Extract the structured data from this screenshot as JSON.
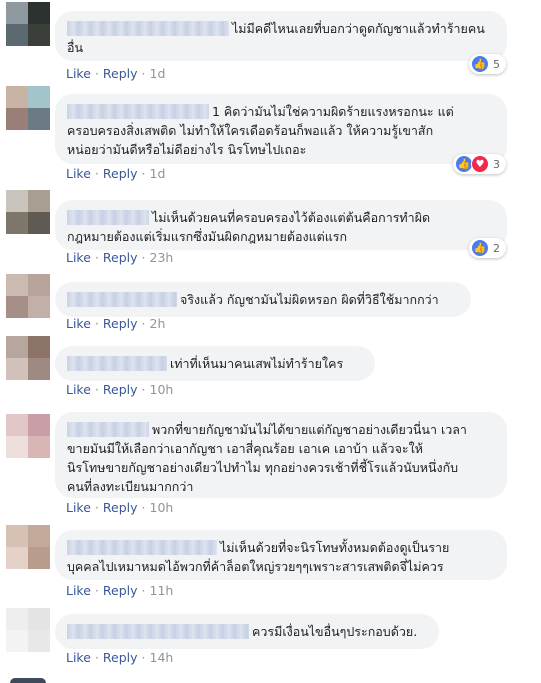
{
  "colors": {
    "link": "#385898",
    "bubble": "#f2f3f5",
    "meta": "#90949c",
    "like": "#4a7cf0",
    "love": "#f0284a"
  },
  "actions": {
    "like": "Like",
    "reply": "Reply",
    "separator": "·"
  },
  "comments": [
    {
      "text": "ไม่มีคดีไหนเลยที่บอกว่าดูดกัญชาแล้วทำร้ายคน\nอื่น",
      "time": "1d",
      "reactions": {
        "icons": [
          "like-icon"
        ],
        "count": "5"
      }
    },
    {
      "text": "1 คิดว่ามันไม่ใช่ความผิดร้ายแรงหรอกนะ แต่\nครอบครองสิ่งเสพติด ไม่ทำให้ใครเดือดร้อนก็พอแล้ว ให้ความรู้เขาสัก\nหน่อยว่ามันดีหรือไม่ดีอย่างไร นิรโทษไปเถอะ",
      "time": "1d",
      "reactions": {
        "icons": [
          "like-icon",
          "love-icon"
        ],
        "count": "3"
      }
    },
    {
      "text": "ไม่เห็นด้วยคนที่ครอบครองไว้ต้องแต่ต้นคือการทำผิด\nกฎหมายต้องแต่เริ่มแรกซึ่งมันผิดกฎหมายต้องแต่แรก",
      "time": "23h",
      "reactions": {
        "icons": [
          "like-icon"
        ],
        "count": "2"
      }
    },
    {
      "text": "จริงแล้ว กัญชามันไม่ผิดหรอก ผิดที่วิธีใช้มากกว่า",
      "time": "2h"
    },
    {
      "text": "เท่าที่เห็นมาคนเสพไม่ทำร้ายใคร",
      "time": "10h"
    },
    {
      "text": "พวกที่ขายกัญชามันไม่ได้ขายแต่กัญชาอย่างเดียวนี่นา เวลา\nขายมันมีให้เลือกว่าเอากัญชา เอาสี่คุณร้อย เอาเค เอาบ้า แล้วจะให้\nนิรโทษขายกัญชาอย่างเดียวไปทำไม ทุกอย่างควรเช้าที่ชี้โรแล้วนับหนึ่งกับ\nคนที่ลงทะเบียนมากกว่า",
      "time": "10h"
    },
    {
      "text": "ไม่เห็นด้วยที่จะนิรโทษทั้งหมดต้องดูเป็นราย\nบุคคลไปเหมาหมดไอ้พวกที่ค้าล็อตใหญ่รวยๆๆเพราะสารเสพติดจึ่ไม่ควร",
      "time": "11h"
    },
    {
      "text": "ควรมีเงื่อนไขอื่นๆประกอบด้วย.",
      "time": "14h"
    }
  ]
}
